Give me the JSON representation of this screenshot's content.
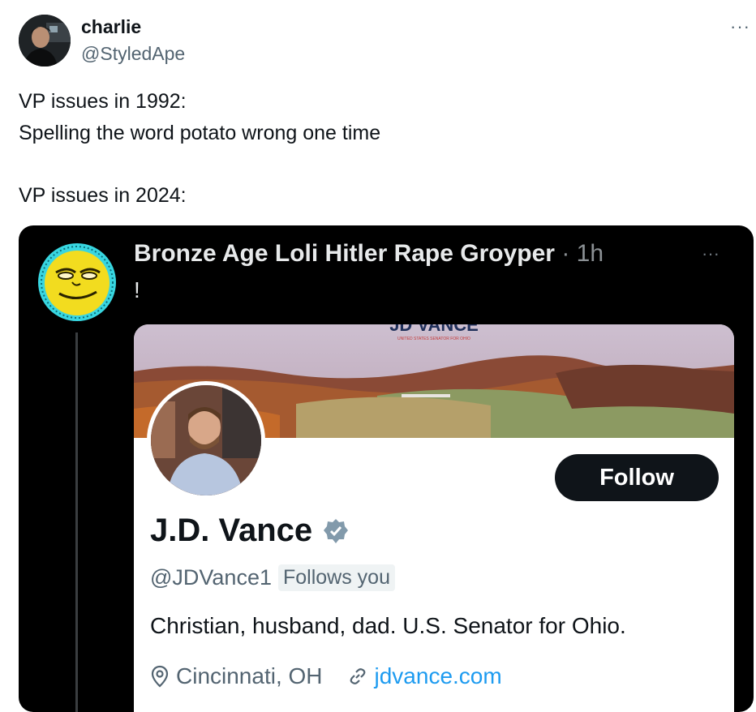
{
  "tweet": {
    "author_name": "charlie",
    "author_handle": "@StyledApe",
    "more_label": "···",
    "text": "VP issues in 1992:\nSpelling the word potato wrong one time\n\nVP issues in 2024:"
  },
  "quoted": {
    "author_name": "Bronze Age Loli Hitler Rape Groyper",
    "time": " · 1h",
    "text": "!",
    "more_label": "···",
    "profile_card": {
      "banner_text": "JD VANCE",
      "banner_subtext": "UNITED STATES SENATOR FOR OHIO",
      "follow_label": "Follow",
      "name": "J.D. Vance",
      "handle": "@JDVance1",
      "follows_you": "Follows you",
      "bio": "Christian, husband, dad. U.S. Senator for Ohio.",
      "location": "Cincinnati, OH",
      "website": "jdvance.com"
    }
  },
  "colors": {
    "dark_bg": "#000000",
    "follow_bg": "#0f1419",
    "link": "#1d9bf0",
    "verified_badge": "#829aab"
  },
  "icons": {
    "verified": "verified-badge-icon",
    "location": "location-pin-icon",
    "link": "link-icon"
  }
}
